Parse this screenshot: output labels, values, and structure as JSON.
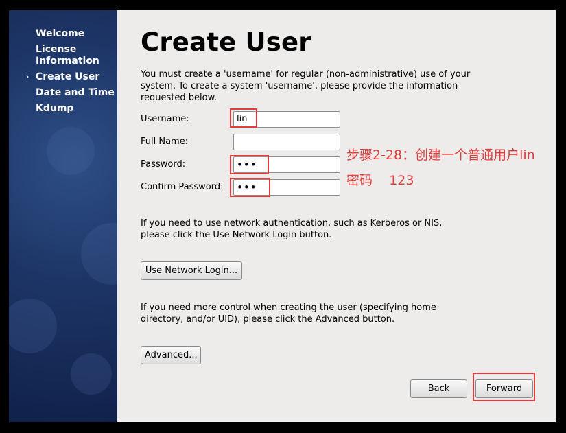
{
  "sidebar": {
    "items": [
      {
        "label": "Welcome",
        "current": false
      },
      {
        "label": "License Information",
        "current": false
      },
      {
        "label": "Create User",
        "current": true
      },
      {
        "label": "Date and Time",
        "current": false
      },
      {
        "label": "Kdump",
        "current": false
      }
    ],
    "current_marker": "›"
  },
  "page": {
    "title": "Create User",
    "intro": "You must create a 'username' for regular (non-administrative) use of your system.  To create a system 'username', please provide the information requested below.",
    "network_note": "If you need to use network authentication, such as Kerberos or NIS, please click the Use Network Login button.",
    "advanced_note": "If you need more control when creating the user (specifying home directory, and/or UID), please click the Advanced button."
  },
  "form": {
    "username_label": "Username:",
    "username_value": "lin",
    "fullname_label": "Full Name:",
    "fullname_value": "",
    "password_label": "Password:",
    "password_value": "•••",
    "confirm_label": "Confirm Password:",
    "confirm_value": "•••"
  },
  "buttons": {
    "network_login": "Use Network Login...",
    "advanced": "Advanced...",
    "back": "Back",
    "forward": "Forward"
  },
  "annotation": {
    "line1": "步骤2-28：创建一个普通用户lin",
    "line2": "密码    123",
    "color": "#e03c3c"
  }
}
